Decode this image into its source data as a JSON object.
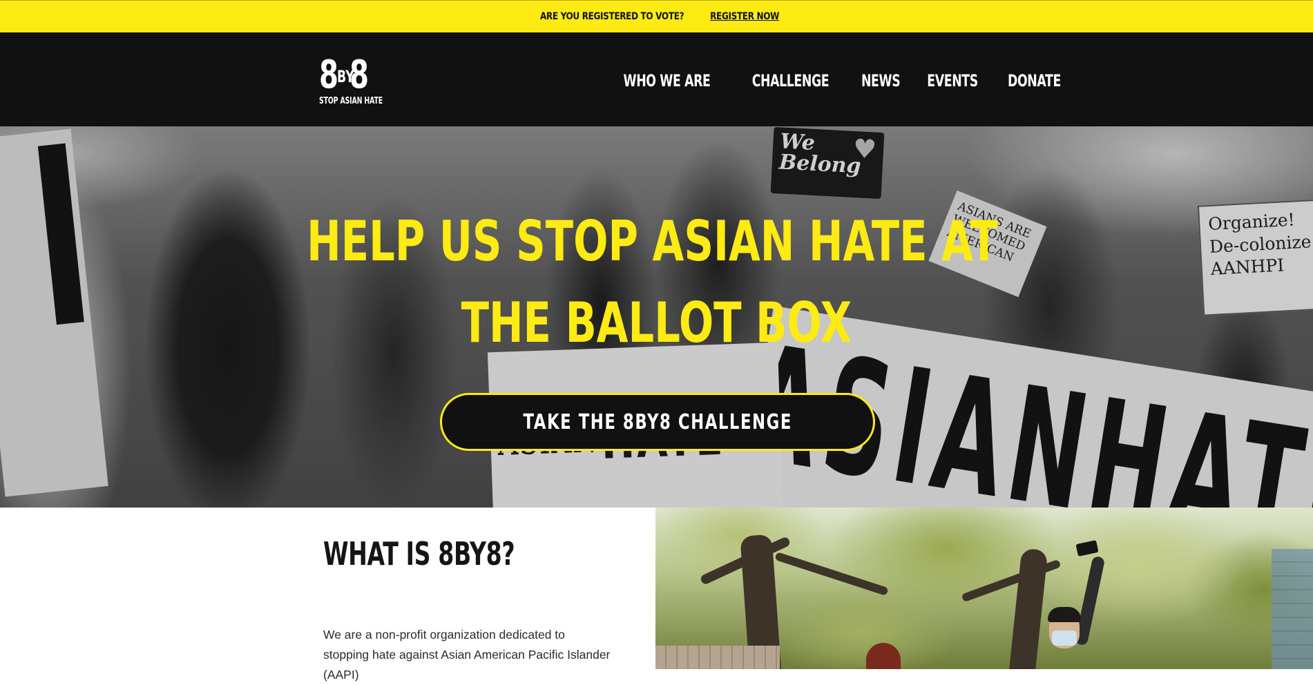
{
  "announcement": {
    "question": "ARE YOU REGISTERED TO VOTE?",
    "link_label": "REGISTER NOW"
  },
  "header": {
    "logo": {
      "num1": "8",
      "by": "BY",
      "num2": "8",
      "tagline": "STOP ASIAN HATE"
    },
    "nav": [
      {
        "label": "WHO WE ARE"
      },
      {
        "label": "CHALLENGE"
      },
      {
        "label": "NEWS"
      },
      {
        "label": "EVENTS"
      },
      {
        "label": "DONATE"
      }
    ]
  },
  "hero": {
    "heading_line1": "HELP US STOP ASIAN HATE AT",
    "heading_line2": "THE BALLOT BOX",
    "cta_label": "TAKE THE 8BY8 CHALLENGE",
    "signs": {
      "we_belong": "We Belong",
      "organize": "Organize! De-colonize AANHPI",
      "welcomed": "ASIANS ARE WELCOMED AMERICAN",
      "big_banner": "ASIANHATE",
      "stop_word": "ASIAN",
      "stop_hate": "HATE"
    }
  },
  "about": {
    "title": "WHAT IS 8BY8?",
    "body": "We are a non-profit organization dedicated to stopping hate against Asian American Pacific Islander (AAPI)"
  },
  "colors": {
    "brand_yellow": "#FEEB13",
    "header_black": "#111111",
    "text_dark": "#151515"
  }
}
